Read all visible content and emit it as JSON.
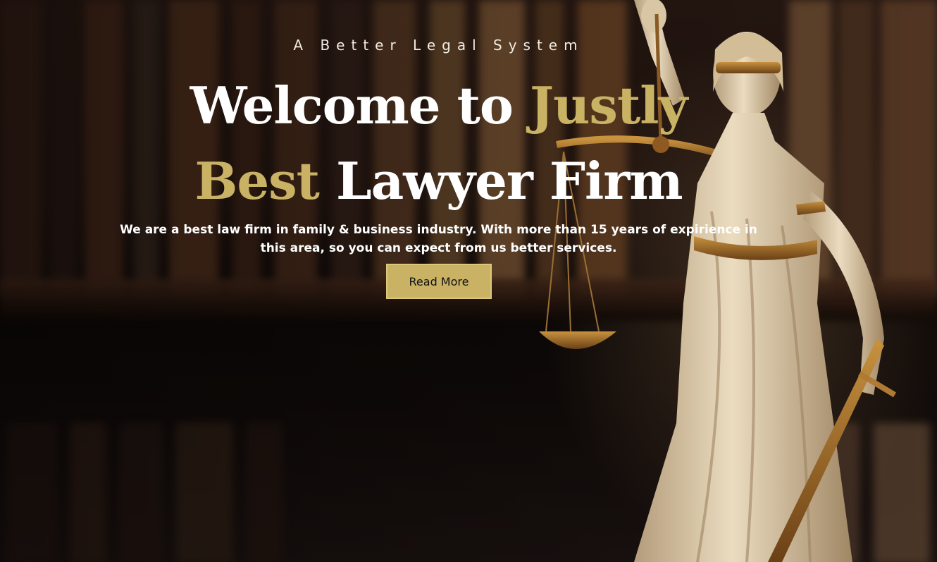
{
  "hero": {
    "eyebrow": "A Better Legal System",
    "headline": {
      "line1_white": "Welcome to ",
      "line1_gold": "Justly",
      "line2_gold": "Best",
      "line2_white": " Lawyer Firm"
    },
    "description": "We are a best law firm in family & business industry. With more than 15 years of expirience in this area, so you can expect from us better services.",
    "button_label": "Read More"
  },
  "colors": {
    "accent_gold": "#c9b264",
    "text_white": "#ffffff",
    "background_dark": "#120c0a"
  },
  "images": {
    "background": "blurred-bookshelf-background",
    "statue": "lady-justice-statue"
  }
}
